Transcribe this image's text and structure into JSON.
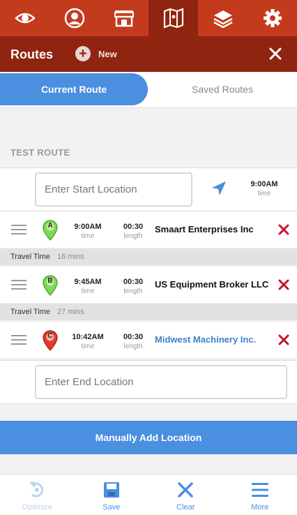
{
  "colors": {
    "nav_bg": "#c43a1c",
    "header_bg": "#8f2410",
    "accent_blue": "#4a8fe0",
    "delete_red": "#c4122e"
  },
  "top_nav": [
    {
      "icon": "eye-icon"
    },
    {
      "icon": "user-circle-icon"
    },
    {
      "icon": "store-icon"
    },
    {
      "icon": "map-icon",
      "active": true
    },
    {
      "icon": "layers-icon"
    },
    {
      "icon": "gear-icon"
    }
  ],
  "header": {
    "title": "Routes",
    "new_label": "New"
  },
  "tabs": {
    "current": "Current Route",
    "saved": "Saved Routes"
  },
  "route": {
    "name": "TEST ROUTE",
    "start": {
      "placeholder": "Enter Start Location",
      "time": "9:00AM",
      "time_label": "time"
    },
    "stops": [
      {
        "letter": "A",
        "pin_color": "#7ed957",
        "time": "9:00AM",
        "time_label": "time",
        "length": "00:30",
        "length_label": "length",
        "name": "Smaart Enterprises Inc"
      },
      {
        "letter": "B",
        "pin_color": "#7ed957",
        "time": "9:45AM",
        "time_label": "time",
        "length": "00:30",
        "length_label": "length",
        "name": "US Equipment Broker LLC"
      },
      {
        "letter": "C",
        "pin_color": "#e23b2c",
        "time": "10:42AM",
        "time_label": "time",
        "length": "00:30",
        "length_label": "length",
        "name": "Midwest Machinery Inc."
      }
    ],
    "travel": [
      {
        "label": "Travel Time",
        "value": "16 mins"
      },
      {
        "label": "Travel Time",
        "value": "27 mins"
      }
    ],
    "end": {
      "placeholder": "Enter End Location"
    }
  },
  "add_button_label": "Manually Add Location",
  "bottom_bar": {
    "optimize": "Optimize",
    "save": "Save",
    "clear": "Clear",
    "more": "More"
  }
}
